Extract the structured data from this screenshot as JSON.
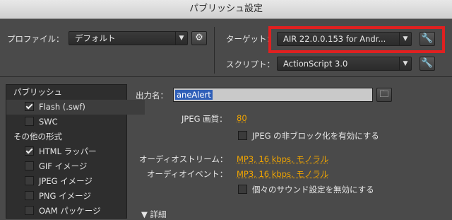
{
  "window": {
    "title": "パブリッシュ設定"
  },
  "top": {
    "profile_label": "プロファイル：",
    "profile_value": "デフォルト",
    "target_label": "ターゲット：",
    "target_value": "AIR 22.0.0.153 for Andr...",
    "script_label": "スクリプト：",
    "script_value": "ActionScript 3.0",
    "accent_red": "#e02020"
  },
  "sidebar": {
    "items": [
      {
        "label": "パブリッシュ",
        "type": "header"
      },
      {
        "label": "Flash (.swf)",
        "checked": true,
        "selected": true
      },
      {
        "label": "SWC",
        "checked": false
      },
      {
        "label": "その他の形式",
        "type": "header"
      },
      {
        "label": "HTML ラッパー",
        "checked": true
      },
      {
        "label": "GIF イメージ",
        "checked": false
      },
      {
        "label": "JPEG イメージ",
        "checked": false
      },
      {
        "label": "PNG イメージ",
        "checked": false
      },
      {
        "label": "OAM パッケージ",
        "checked": false
      }
    ]
  },
  "main": {
    "output_label": "出力名：",
    "output_value": "aneAlert",
    "jpeg_quality_label": "JPEG 画質：",
    "jpeg_quality_value": "80",
    "jpeg_deblock_label": "JPEG の非ブロック化を有効にする",
    "audio_stream_label": "オーディオストリーム：",
    "audio_stream_value": "MP3, 16 kbps, モノラル",
    "audio_event_label": "オーディオイベント：",
    "audio_event_value": "MP3, 16 kbps, モノラル",
    "override_sound_label": "個々のサウンド設定を無効にする",
    "advanced_label": "詳細",
    "orange_accent": "#f0a400"
  }
}
